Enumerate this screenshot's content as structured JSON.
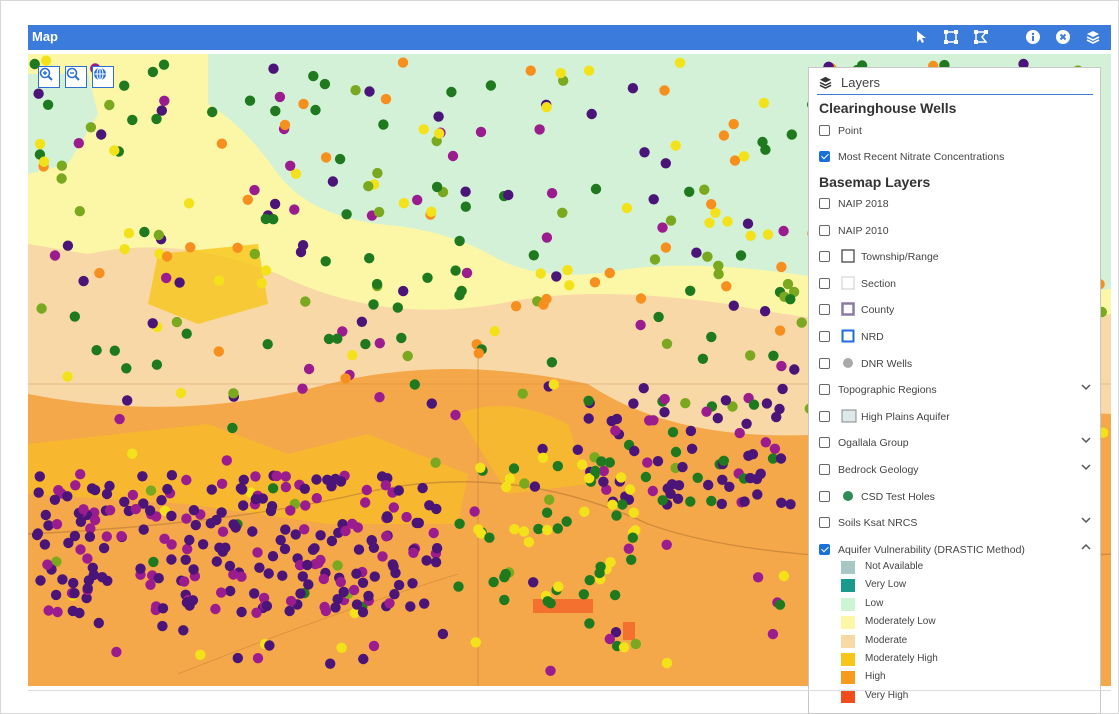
{
  "window": {
    "title": "Map"
  },
  "toolbar": {
    "icons": [
      "cursor-icon",
      "select-box-icon",
      "select-polygon-icon",
      "info-icon",
      "clear-icon",
      "layers-icon"
    ]
  },
  "map_controls": {
    "icons": [
      "zoom-in-icon",
      "zoom-out-icon",
      "globe-icon"
    ]
  },
  "layers_panel": {
    "title": "Layers",
    "section_wells": "Clearinghouse Wells",
    "wells": [
      {
        "label": "Point",
        "checked": false
      },
      {
        "label": "Most Recent Nitrate Concentrations",
        "checked": true
      }
    ],
    "section_basemap": "Basemap Layers",
    "basemap": [
      {
        "label": "NAIP 2018",
        "checked": false
      },
      {
        "label": "NAIP 2010",
        "checked": false
      },
      {
        "label": "Township/Range",
        "checked": false,
        "symbol": "square-dark"
      },
      {
        "label": "Section",
        "checked": false,
        "symbol": "square-light"
      },
      {
        "label": "County",
        "checked": false,
        "symbol": "square-purple"
      },
      {
        "label": "NRD",
        "checked": false,
        "symbol": "square-blue"
      },
      {
        "label": "DNR Wells",
        "checked": false,
        "symbol": "dot-gray"
      },
      {
        "label": "Topographic Regions",
        "checked": false,
        "expand": "down"
      },
      {
        "label": "High Plains Aquifer",
        "checked": false,
        "symbol": "square-fill-light"
      },
      {
        "label": "Ogallala Group",
        "checked": false,
        "expand": "down"
      },
      {
        "label": "Bedrock Geology",
        "checked": false,
        "expand": "down"
      },
      {
        "label": "CSD Test Holes",
        "checked": false,
        "symbol": "dot-green"
      },
      {
        "label": "Soils Ksat NRCS",
        "checked": false,
        "expand": "down"
      },
      {
        "label": "Aquifer Vulnerability (DRASTIC Method)",
        "checked": true,
        "expand": "up"
      }
    ],
    "legend": [
      {
        "label": "Not Available",
        "color": "#a9c6c6"
      },
      {
        "label": "Very Low",
        "color": "#1a9a8c"
      },
      {
        "label": "Low",
        "color": "#ccf5d4"
      },
      {
        "label": "Moderately Low",
        "color": "#fbf7a6"
      },
      {
        "label": "Moderate",
        "color": "#f8d9a3"
      },
      {
        "label": "Moderately High",
        "color": "#f8c51a"
      },
      {
        "label": "High",
        "color": "#f79a1e"
      },
      {
        "label": "Very High",
        "color": "#f24b1c"
      }
    ]
  },
  "colors": {
    "titlebar": "#3a7bdc",
    "well_green": "#1f7a1f",
    "well_olive": "#7aa81e",
    "well_yellow": "#f3e21a",
    "well_orange": "#f78f1e",
    "well_purple": "#4a1478",
    "well_magenta": "#9b1c8f"
  }
}
